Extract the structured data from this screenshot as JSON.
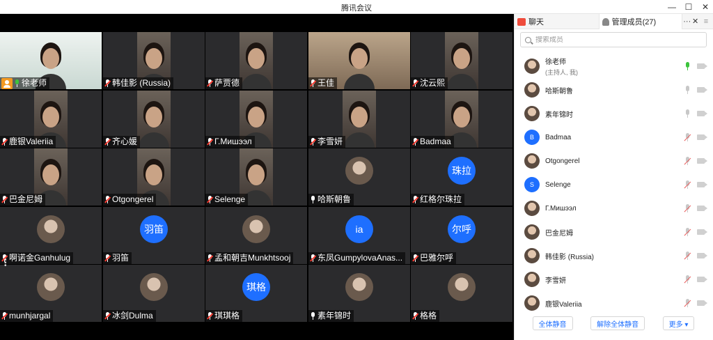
{
  "window": {
    "title": "腾讯会议",
    "minimize": "—",
    "maximize": "☐",
    "close": "✕"
  },
  "tiles": [
    {
      "name": "徐老师",
      "mic": "on",
      "host": true,
      "kind": "video-wide"
    },
    {
      "name": "韩佳影 (Russia)",
      "mic": "off",
      "kind": "video"
    },
    {
      "name": "萨贾德",
      "mic": "off",
      "kind": "video"
    },
    {
      "name": "王佳",
      "mic": "off",
      "kind": "video-wide"
    },
    {
      "name": "沈云熙",
      "mic": "off",
      "kind": "video"
    },
    {
      "name": "鹿银Valeriia",
      "mic": "off",
      "kind": "video"
    },
    {
      "name": "齐心媛",
      "mic": "off",
      "kind": "video"
    },
    {
      "name": "Г.Мишээл",
      "mic": "off",
      "kind": "video"
    },
    {
      "name": "李雪妍",
      "mic": "off",
      "kind": "video"
    },
    {
      "name": "Badmaa",
      "mic": "off",
      "kind": "video"
    },
    {
      "name": "巴金尼姆",
      "mic": "off",
      "kind": "video"
    },
    {
      "name": "Otgongerel",
      "mic": "off",
      "kind": "video"
    },
    {
      "name": "Selenge",
      "mic": "off",
      "kind": "video"
    },
    {
      "name": "哈斯朝鲁",
      "mic": "muted",
      "kind": "photo"
    },
    {
      "name": "红格尔珠拉",
      "mic": "off",
      "kind": "initials",
      "initials": "珠拉"
    },
    {
      "name": "啊诺金Ganhulug",
      "mic": "off",
      "kind": "photo"
    },
    {
      "name": "羽笛",
      "mic": "off",
      "kind": "initials",
      "initials": "羽笛"
    },
    {
      "name": "孟和朝吉Munkhtsooj",
      "mic": "off",
      "kind": "photo"
    },
    {
      "name": "东凤GumpylovaAnas...",
      "mic": "off",
      "kind": "initials",
      "initials": "ia"
    },
    {
      "name": "巴雅尔呼",
      "mic": "off",
      "kind": "initials",
      "initials": "尔呼"
    },
    {
      "name": "munhjargal",
      "mic": "off",
      "kind": "photo"
    },
    {
      "name": "冰剑Dulma",
      "mic": "off",
      "kind": "photo"
    },
    {
      "name": "琪琪格",
      "mic": "off",
      "kind": "initials",
      "initials": "琪格"
    },
    {
      "name": "素年锦时",
      "mic": "muted",
      "kind": "photo"
    },
    {
      "name": "格格",
      "mic": "off",
      "kind": "photo"
    }
  ],
  "panel": {
    "tabs": {
      "chat": "聊天",
      "members": "管理成员(27)",
      "more": "···",
      "close": "✕",
      "menu": "≡"
    },
    "search_placeholder": "搜索成员",
    "members": [
      {
        "name": "徐老师",
        "sub": "(主持人, 我)",
        "mic": "on",
        "avatar": "photo"
      },
      {
        "name": "哈斯朝鲁",
        "mic": "idle",
        "avatar": "photo"
      },
      {
        "name": "素年锦时",
        "mic": "idle",
        "avatar": "photo"
      },
      {
        "name": "Badmaa",
        "mic": "off",
        "avatar": "letter",
        "letter": "B"
      },
      {
        "name": "Otgongerel",
        "mic": "off",
        "avatar": "photo"
      },
      {
        "name": "Selenge",
        "mic": "off",
        "avatar": "letter",
        "letter": "S"
      },
      {
        "name": "Г.Мишээл",
        "mic": "off",
        "avatar": "photo"
      },
      {
        "name": "巴金尼姆",
        "mic": "off",
        "avatar": "photo"
      },
      {
        "name": "韩佳影 (Russia)",
        "mic": "off",
        "avatar": "photo"
      },
      {
        "name": "李雪妍",
        "mic": "off",
        "avatar": "photo"
      },
      {
        "name": "鹿银Valeriia",
        "mic": "off",
        "avatar": "photo"
      }
    ],
    "footer": {
      "mute_all": "全体静音",
      "unmute_all": "解除全体静音",
      "more": "更多 ▾"
    }
  }
}
